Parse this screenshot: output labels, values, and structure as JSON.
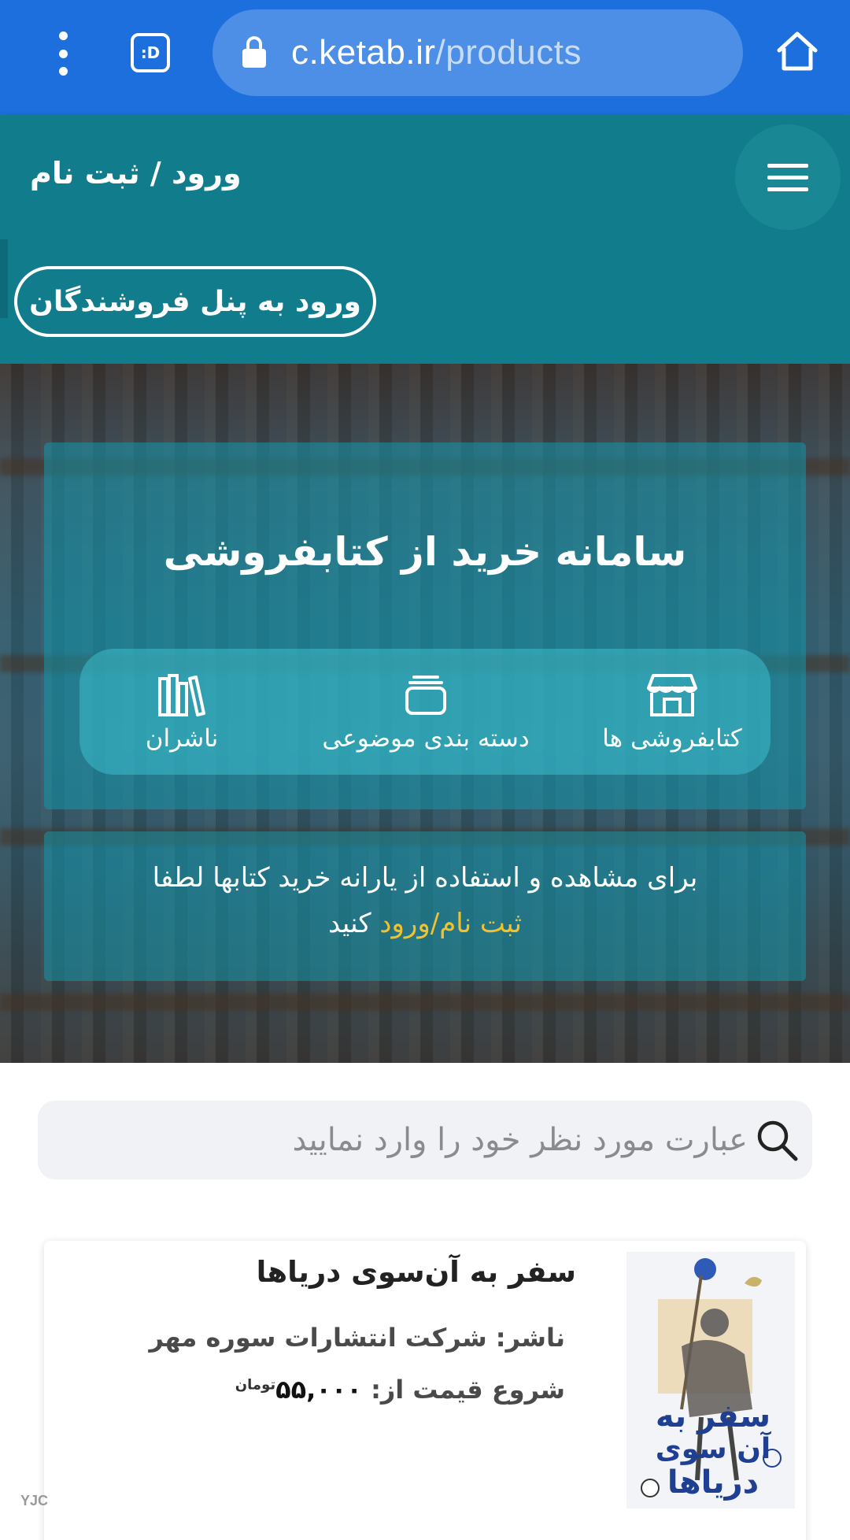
{
  "browser": {
    "url_host": "c.ketab.ir",
    "url_path": "/products",
    "tab_icon_label": ":D",
    "icons": [
      "more-vertical-icon",
      "tab-switcher-icon",
      "lock-icon",
      "home-icon"
    ]
  },
  "header": {
    "login_register": "ورود / ثبت نام",
    "menu_icon": "hamburger-icon"
  },
  "seller_panel": {
    "button_label": "ورود به پنل فروشندگان"
  },
  "hero": {
    "title": "سامانه خرید از کتابفروشی",
    "quick_links": [
      {
        "label": "کتابفروشی ها",
        "icon": "storefront-icon"
      },
      {
        "label": "دسته بندی موضوعی",
        "icon": "category-stack-icon"
      },
      {
        "label": "ناشران",
        "icon": "books-icon"
      }
    ],
    "notice": {
      "line1": "برای مشاهده و استفاده از یارانه خرید کتابها لطفا",
      "link_text": "ثبت نام/ورود",
      "line2_suffix": " کنید"
    }
  },
  "search": {
    "placeholder": "عبارت مورد نظر خود را وارد نمایید"
  },
  "products": [
    {
      "title": "سفر به آن‌سوی دریاها",
      "publisher_label": "ناشر:",
      "publisher": "شرکت انتشارات سوره مهر",
      "price_label": "شروع قیمت از:",
      "price": "۵۵,۰۰۰",
      "price_unit": "تومان",
      "cover_text": "سفر به آن سوی دریاها"
    }
  ],
  "watermark": "YJC",
  "colors": {
    "browser_blue": "#1c6fdc",
    "header_teal": "#117c8c",
    "notice_link": "#f2c12e"
  }
}
